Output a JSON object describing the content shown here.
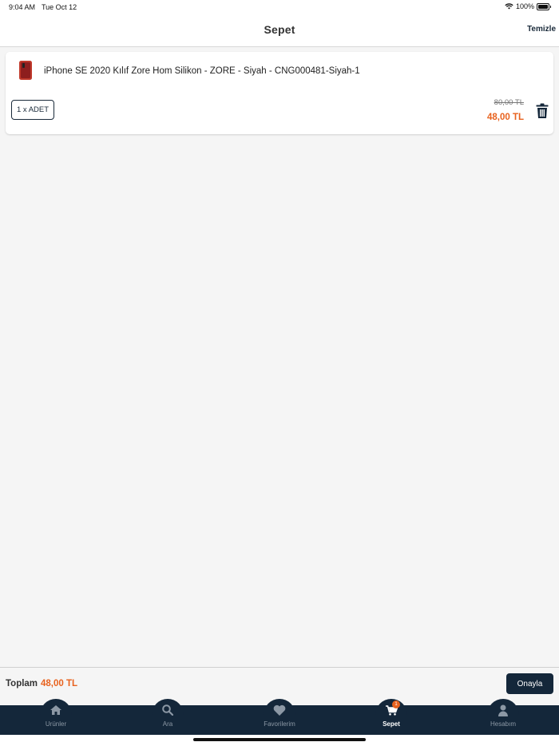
{
  "status_bar": {
    "time": "9:04 AM",
    "date": "Tue Oct 12",
    "battery": "100%"
  },
  "nav": {
    "title": "Sepet",
    "clear_label": "Temizle"
  },
  "cart_items": [
    {
      "name": "iPhone SE 2020 Kılıf Zore Hom Silikon - ZORE - Siyah - CNG000481-Siyah-1",
      "quantity_label": "1 x ADET",
      "old_price": "80,00 TL",
      "price": "48,00 TL",
      "thumbnail_icon": "phone-case-thumbnail"
    }
  ],
  "total": {
    "label": "Toplam",
    "value": "48,00 TL",
    "confirm_label": "Onayla"
  },
  "tabs": [
    {
      "label": "Ürünler",
      "icon": "home-icon"
    },
    {
      "label": "Ara",
      "icon": "search-icon"
    },
    {
      "label": "Favorilerim",
      "icon": "heart-icon"
    },
    {
      "label": "Sepet",
      "icon": "cart-icon",
      "badge": "1",
      "active": true
    },
    {
      "label": "Hesabım",
      "icon": "user-icon"
    }
  ],
  "colors": {
    "primary": "#14273a",
    "accent": "#e8621e",
    "background": "#f5f5f5"
  }
}
